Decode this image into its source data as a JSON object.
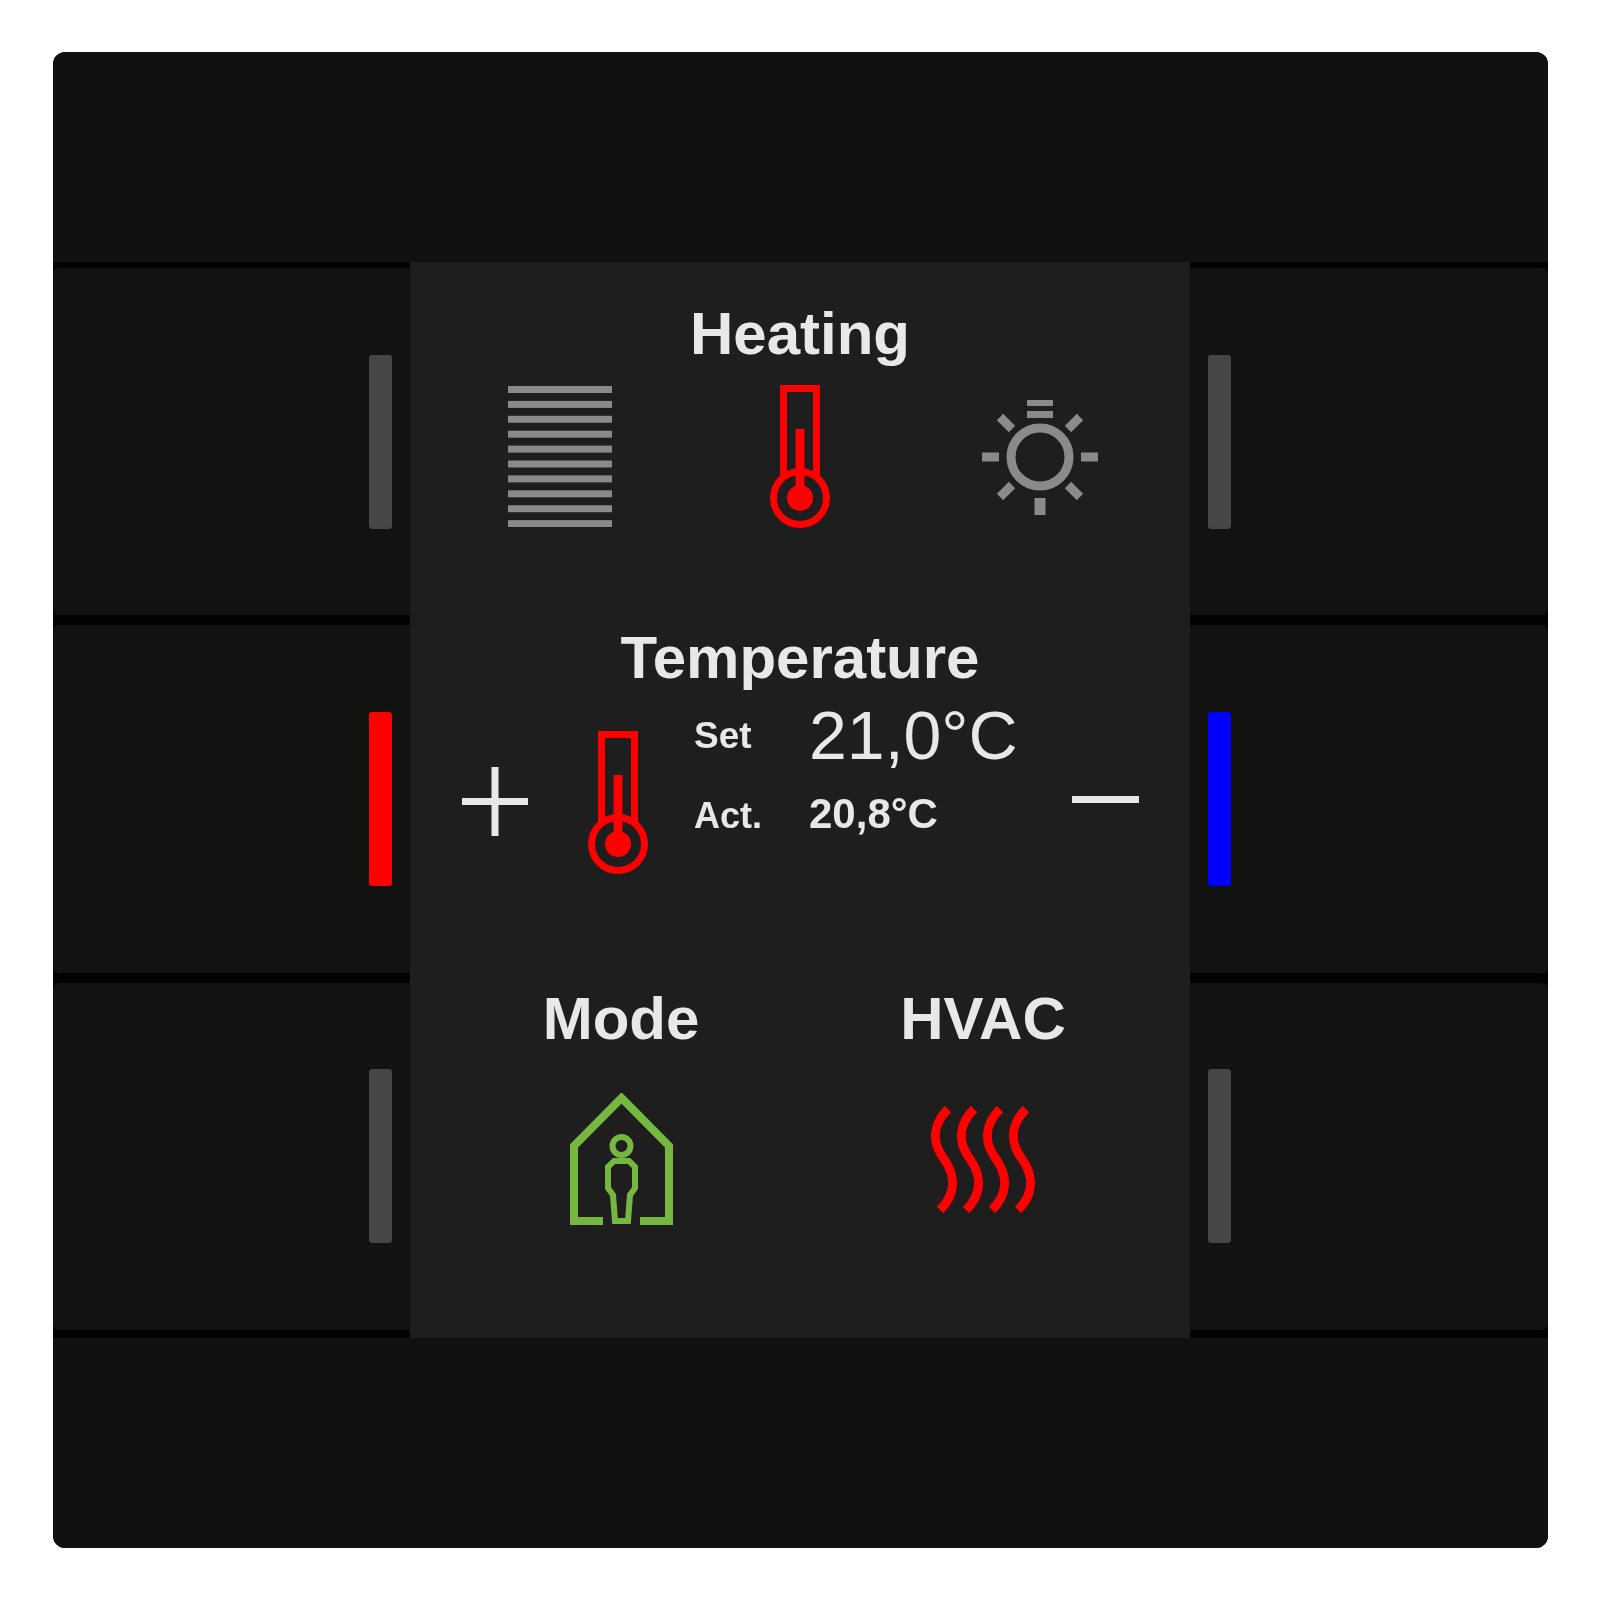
{
  "keys": {
    "left": [
      {
        "color": "#464646"
      },
      {
        "color": "#ff0000"
      },
      {
        "color": "#464646"
      }
    ],
    "right": [
      {
        "color": "#464646"
      },
      {
        "color": "#0000ff"
      },
      {
        "color": "#464646"
      }
    ]
  },
  "display": {
    "title": "Heating",
    "functions": [
      {
        "kind": "blinds",
        "selected": false
      },
      {
        "kind": "thermometer",
        "selected": true
      },
      {
        "kind": "sun",
        "selected": false
      }
    ],
    "temperature": {
      "title": "Temperature",
      "set_label": "Set",
      "set_value": "21,0°C",
      "actual_label": "Act.",
      "actual_value": "20,8°C"
    },
    "status": [
      {
        "kind": "presence",
        "label": "Mode",
        "color": "#76b83f"
      },
      {
        "kind": "heating",
        "label": "HVAC",
        "color": "#ff0000"
      }
    ]
  }
}
